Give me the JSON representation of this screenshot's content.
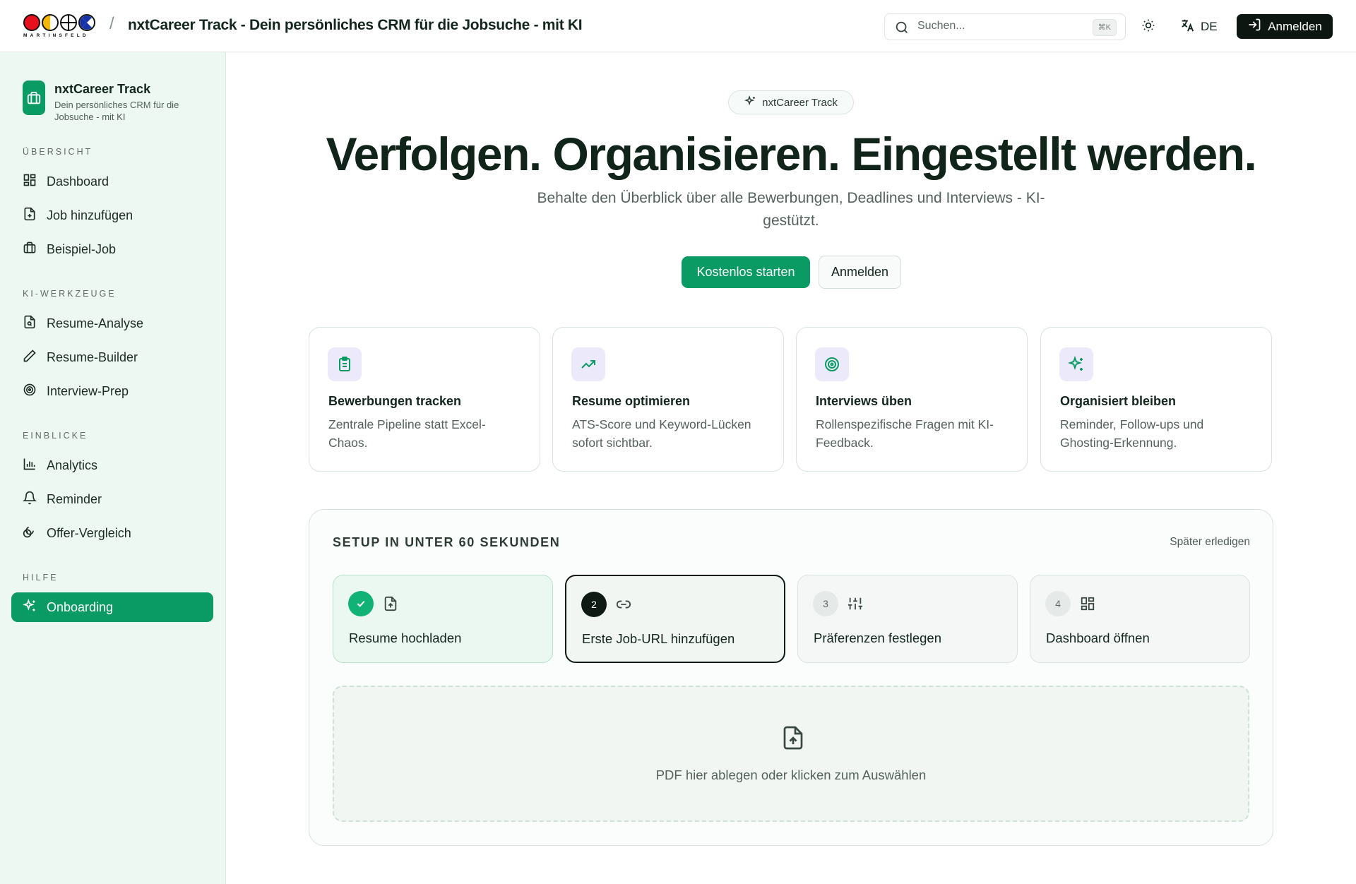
{
  "header": {
    "logo_text": "MARTINSFELD",
    "separator": "/",
    "title": "nxtCareer Track - Dein persönliches CRM für die Jobsuche - mit KI",
    "search_placeholder": "Suchen...",
    "search_shortcut": "⌘K",
    "theme_icon": "sun-icon",
    "language": "DE",
    "login_label": "Anmelden"
  },
  "sidebar": {
    "brand_name": "nxtCareer Track",
    "brand_sub": "Dein persönliches CRM für die Jobsuche - mit KI",
    "sections": [
      {
        "label": "ÜBERSICHT",
        "items": [
          {
            "label": "Dashboard",
            "icon": "dashboard-icon"
          },
          {
            "label": "Job hinzufügen",
            "icon": "file-plus-icon"
          },
          {
            "label": "Beispiel-Job",
            "icon": "briefcase-icon"
          }
        ]
      },
      {
        "label": "KI-WERKZEUGE",
        "items": [
          {
            "label": "Resume-Analyse",
            "icon": "file-search-icon"
          },
          {
            "label": "Resume-Builder",
            "icon": "pen-icon"
          },
          {
            "label": "Interview-Prep",
            "icon": "target-icon"
          }
        ]
      },
      {
        "label": "EINBLICKE",
        "items": [
          {
            "label": "Analytics",
            "icon": "bar-chart-icon"
          },
          {
            "label": "Reminder",
            "icon": "bell-icon"
          },
          {
            "label": "Offer-Vergleich",
            "icon": "coins-icon"
          }
        ]
      },
      {
        "label": "HILFE",
        "items": [
          {
            "label": "Onboarding",
            "icon": "sparkles-icon",
            "active": true
          }
        ]
      }
    ]
  },
  "main": {
    "badge": "nxtCareer Track",
    "hero_title": "Verfolgen. Organisieren. Eingestellt werden.",
    "subtitle": "Behalte den Überblick über alle Bewerbungen, Deadlines und Interviews - KI-gestützt.",
    "cta_primary": "Kostenlos starten",
    "cta_secondary": "Anmelden",
    "features": [
      {
        "title": "Bewerbungen tracken",
        "desc": "Zentrale Pipeline statt Excel-Chaos.",
        "icon": "clipboard-icon"
      },
      {
        "title": "Resume optimieren",
        "desc": "ATS-Score und Keyword-Lücken sofort sichtbar.",
        "icon": "trending-up-icon"
      },
      {
        "title": "Interviews üben",
        "desc": "Rollenspezifische Fragen mit KI-Feedback.",
        "icon": "target-icon"
      },
      {
        "title": "Organisiert bleiben",
        "desc": "Reminder, Follow-ups und Ghosting-Erkennung.",
        "icon": "sparkles-icon"
      }
    ],
    "setup": {
      "title": "SETUP IN UNTER 60 SEKUNDEN",
      "later": "Später erledigen",
      "steps": [
        {
          "num": "",
          "label": "Resume hochladen",
          "state": "done",
          "icon": "file-upload-icon"
        },
        {
          "num": "2",
          "label": "Erste Job-URL hinzufügen",
          "state": "current",
          "icon": "link-icon"
        },
        {
          "num": "3",
          "label": "Präferenzen festlegen",
          "state": "pending",
          "icon": "sliders-icon"
        },
        {
          "num": "4",
          "label": "Dashboard öffnen",
          "state": "pending",
          "icon": "dashboard-icon"
        }
      ],
      "dropzone_text": "PDF hier ablegen oder klicken zum Auswählen"
    }
  },
  "colors": {
    "accent": "#0a9a63",
    "sidebar_bg": "#edf8f3",
    "dark": "#0d1611",
    "icon_tile": "#ece9fb"
  }
}
